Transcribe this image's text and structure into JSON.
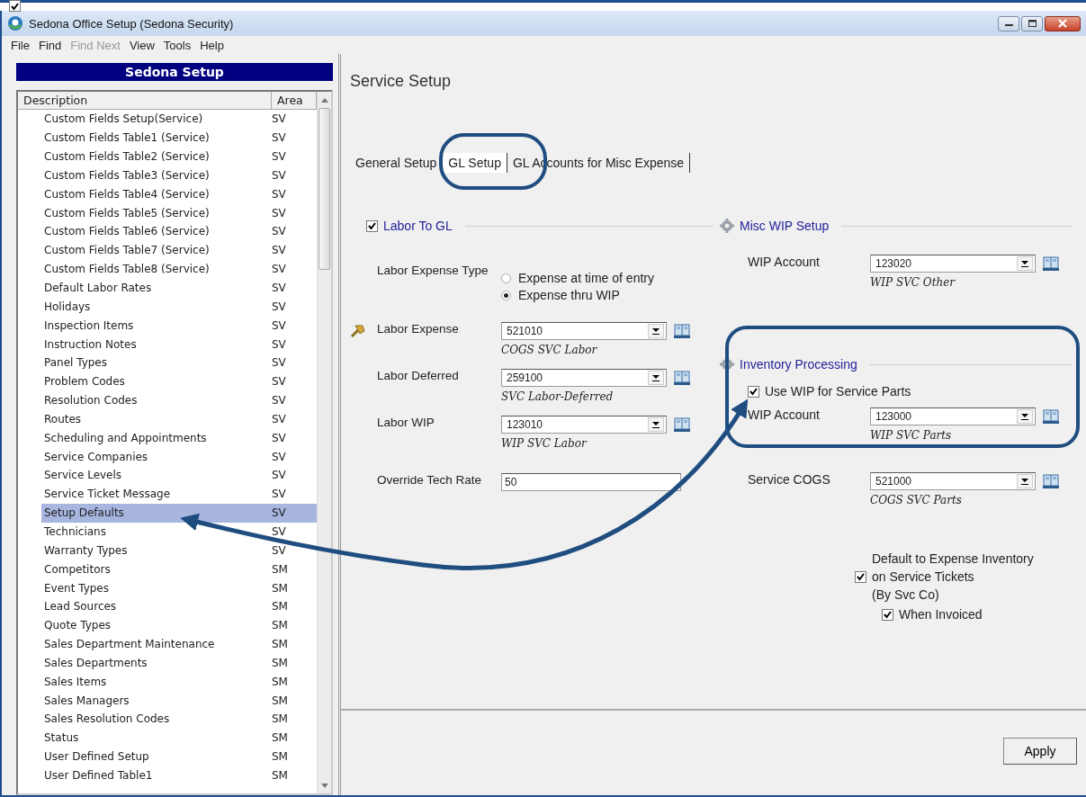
{
  "corner_checkbox": {
    "checked": true
  },
  "window": {
    "title": "Sedona Office Setup (Sedona Security)"
  },
  "menu": [
    {
      "label": "File",
      "disabled": false
    },
    {
      "label": "Find",
      "disabled": false
    },
    {
      "label": "Find Next",
      "disabled": true
    },
    {
      "label": "View",
      "disabled": false
    },
    {
      "label": "Tools",
      "disabled": false
    },
    {
      "label": "Help",
      "disabled": false
    }
  ],
  "sidebar": {
    "title": "Sedona Setup",
    "columns": [
      "Description",
      "Area"
    ],
    "rows": [
      {
        "description": "Custom Fields Setup(Service)",
        "area": "SV",
        "selected": false
      },
      {
        "description": "Custom Fields Table1 (Service)",
        "area": "SV",
        "selected": false
      },
      {
        "description": "Custom Fields Table2 (Service)",
        "area": "SV",
        "selected": false
      },
      {
        "description": "Custom Fields Table3 (Service)",
        "area": "SV",
        "selected": false
      },
      {
        "description": "Custom Fields Table4 (Service)",
        "area": "SV",
        "selected": false
      },
      {
        "description": "Custom Fields Table5 (Service)",
        "area": "SV",
        "selected": false
      },
      {
        "description": "Custom Fields Table6 (Service)",
        "area": "SV",
        "selected": false
      },
      {
        "description": "Custom Fields Table7 (Service)",
        "area": "SV",
        "selected": false
      },
      {
        "description": "Custom Fields Table8 (Service)",
        "area": "SV",
        "selected": false
      },
      {
        "description": "Default Labor Rates",
        "area": "SV",
        "selected": false
      },
      {
        "description": "Holidays",
        "area": "SV",
        "selected": false
      },
      {
        "description": "Inspection Items",
        "area": "SV",
        "selected": false
      },
      {
        "description": "Instruction Notes",
        "area": "SV",
        "selected": false
      },
      {
        "description": "Panel Types",
        "area": "SV",
        "selected": false
      },
      {
        "description": "Problem Codes",
        "area": "SV",
        "selected": false
      },
      {
        "description": "Resolution Codes",
        "area": "SV",
        "selected": false
      },
      {
        "description": "Routes",
        "area": "SV",
        "selected": false
      },
      {
        "description": "Scheduling and Appointments",
        "area": "SV",
        "selected": false
      },
      {
        "description": "Service Companies",
        "area": "SV",
        "selected": false
      },
      {
        "description": "Service Levels",
        "area": "SV",
        "selected": false
      },
      {
        "description": "Service Ticket Message",
        "area": "SV",
        "selected": false
      },
      {
        "description": "Setup Defaults",
        "area": "SV",
        "selected": true
      },
      {
        "description": "Technicians",
        "area": "SV",
        "selected": false
      },
      {
        "description": "Warranty Types",
        "area": "SV",
        "selected": false
      },
      {
        "description": "Competitors",
        "area": "SM",
        "selected": false
      },
      {
        "description": "Event Types",
        "area": "SM",
        "selected": false
      },
      {
        "description": "Lead Sources",
        "area": "SM",
        "selected": false
      },
      {
        "description": "Quote Types",
        "area": "SM",
        "selected": false
      },
      {
        "description": "Sales Department Maintenance",
        "area": "SM",
        "selected": false
      },
      {
        "description": "Sales Departments",
        "area": "SM",
        "selected": false
      },
      {
        "description": "Sales Items",
        "area": "SM",
        "selected": false
      },
      {
        "description": "Sales Managers",
        "area": "SM",
        "selected": false
      },
      {
        "description": "Sales Resolution Codes",
        "area": "SM",
        "selected": false
      },
      {
        "description": "Status",
        "area": "SM",
        "selected": false
      },
      {
        "description": "User Defined Setup",
        "area": "SM",
        "selected": false
      },
      {
        "description": "User Defined Table1",
        "area": "SM",
        "selected": false
      }
    ]
  },
  "content": {
    "title": "Service Setup",
    "tabs": [
      {
        "label": "General Setup",
        "selected": false
      },
      {
        "label": "GL Setup",
        "selected": true
      },
      {
        "label": "GL Accounts for Misc Expense",
        "selected": false
      }
    ],
    "labor_to_gl": {
      "label": "Labor To GL",
      "checked": true
    },
    "labor_expense_type": {
      "label": "Labor Expense Type",
      "options": [
        {
          "label": "Expense at time of entry",
          "selected": false
        },
        {
          "label": "Expense thru WIP",
          "selected": true
        }
      ]
    },
    "accounts": [
      {
        "label": "Labor Expense",
        "value": "521010",
        "description": "COGS SVC Labor",
        "flagged": true
      },
      {
        "label": "Labor Deferred",
        "value": "259100",
        "description": "SVC Labor-Deferred",
        "flagged": false
      },
      {
        "label": "Labor WIP",
        "value": "123010",
        "description": "WIP SVC Labor",
        "flagged": false
      }
    ],
    "override_tech_rate": {
      "label": "Override Tech Rate",
      "value": "50"
    },
    "misc_wip": {
      "title": "Misc WIP Setup",
      "account": {
        "label": "WIP Account",
        "value": "123020",
        "description": "WIP SVC Other"
      }
    },
    "inventory": {
      "title": "Inventory Processing",
      "use_wip": {
        "label": "Use WIP for Service Parts",
        "checked": true
      },
      "account": {
        "label": "WIP Account",
        "value": "123000",
        "description": "WIP SVC Parts"
      }
    },
    "service_cogs": {
      "label": "Service COGS",
      "value": "521000",
      "description": "COGS SVC Parts"
    },
    "default_expense": {
      "label": "Default to Expense Inventory\non Service Tickets\n(By Svc Co)",
      "checked": true
    },
    "when_invoiced": {
      "label": "When Invoiced",
      "checked": true
    },
    "apply_button": "Apply"
  }
}
